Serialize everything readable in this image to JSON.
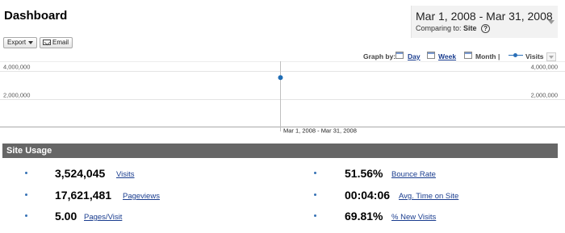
{
  "header": {
    "title": "Dashboard",
    "date_range": "Mar 1, 2008 - Mar 31, 2008",
    "comparing_label": "Comparing to:",
    "comparing_value": "Site",
    "help_glyph": "?"
  },
  "toolbar": {
    "export_label": "Export",
    "email_label": "Email"
  },
  "graph_by": {
    "label": "Graph by:",
    "day": "Day",
    "week": "Week",
    "month": "Month",
    "separator": "|",
    "metric": "Visits"
  },
  "chart_data": {
    "type": "line",
    "x": [
      "Mar 1, 2008 - Mar 31, 2008"
    ],
    "series": [
      {
        "name": "Visits",
        "values": [
          3524045
        ]
      }
    ],
    "ylim": [
      0,
      4000000
    ],
    "yticks": [
      "4,000,000",
      "2,000,000"
    ],
    "ytick_values": [
      4000000,
      2000000
    ],
    "grid": true,
    "color": "#1f6db5"
  },
  "site_usage": {
    "title": "Site Usage",
    "left": [
      {
        "value": "3,524,045",
        "label": "Visits"
      },
      {
        "value": "17,621,481",
        "label": "Pageviews"
      },
      {
        "value": "5.00",
        "label": "Pages/Visit"
      }
    ],
    "right": [
      {
        "value": "51.56%",
        "label": "Bounce Rate"
      },
      {
        "value": "00:04:06",
        "label": "Avg. Time on Site"
      },
      {
        "value": "69.81%",
        "label": "% New Visits"
      }
    ]
  }
}
